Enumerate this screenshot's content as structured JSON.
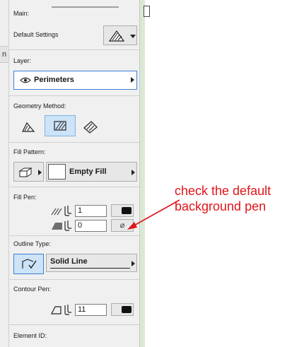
{
  "left_tab": {
    "label": "n"
  },
  "sections": {
    "main": {
      "label": "Main:",
      "default_settings_label": "Default Settings"
    },
    "layer": {
      "label": "Layer:",
      "value": "Perimeters"
    },
    "geometry": {
      "label": "Geometry Method:"
    },
    "fill_pattern": {
      "label": "Fill Pattern:",
      "value": "Empty Fill"
    },
    "fill_pen": {
      "label": "Fill Pen:",
      "foreground_pen": "1",
      "background_pen": "0",
      "background_swatch": "⌀"
    },
    "outline_type": {
      "label": "Outline Type:",
      "value": "Solid Line"
    },
    "contour_pen": {
      "label": "Contour Pen:",
      "value": "11"
    },
    "element_id": {
      "label": "Element ID:"
    }
  },
  "annotation": {
    "line1": "check the default",
    "line2": "background pen",
    "color": "#e0151a"
  }
}
